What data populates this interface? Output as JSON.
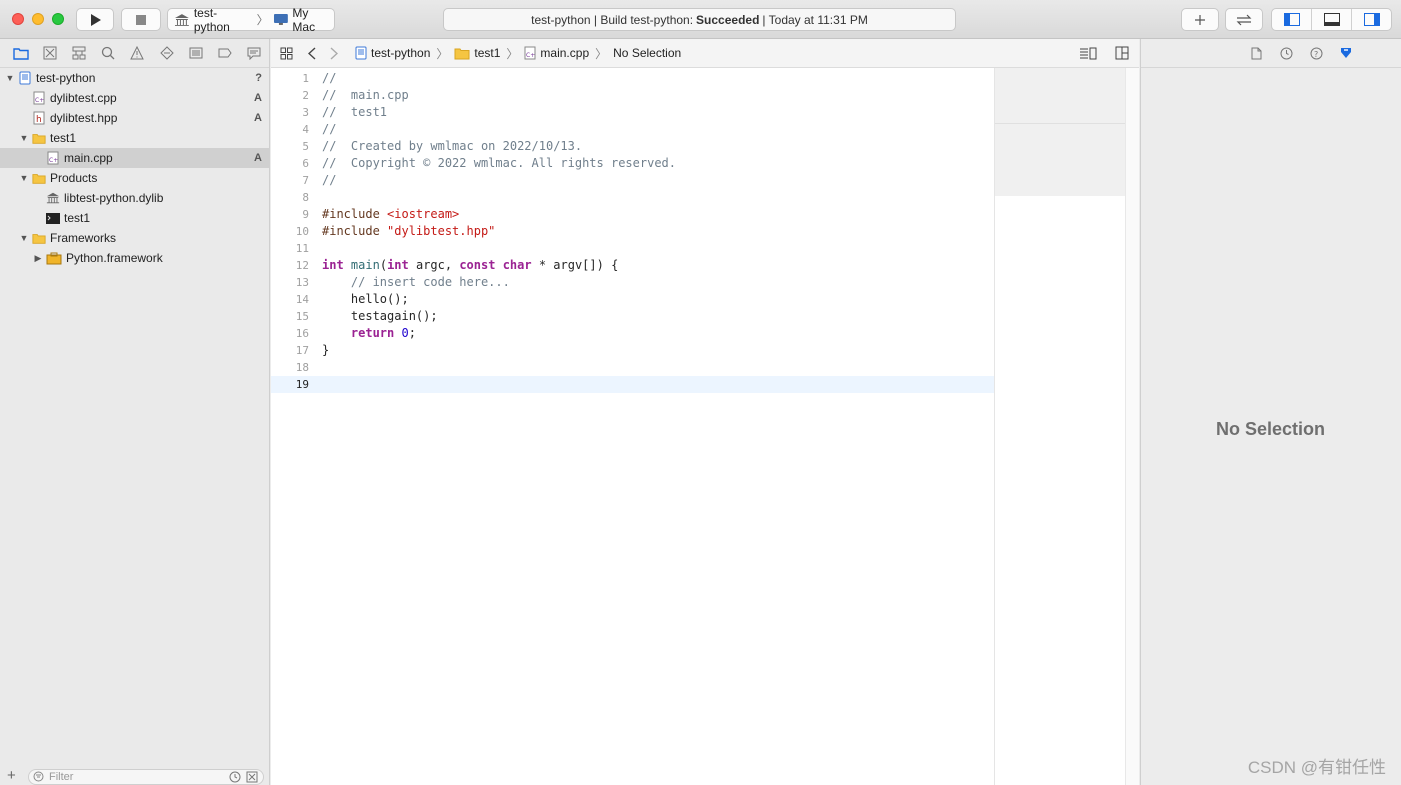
{
  "toolbar": {
    "scheme_name": "test-python",
    "destination": "My Mac",
    "status_prefix": "test-python | Build test-python:",
    "status_result": "Succeeded",
    "status_suffix": "| Today at 11:31 PM"
  },
  "navigator": {
    "tree": [
      {
        "label": "test-python",
        "icon": "project-icon",
        "badge": "?"
      },
      {
        "label": "dylibtest.cpp",
        "icon": "cpp-file-icon",
        "badge": "A"
      },
      {
        "label": "dylibtest.hpp",
        "icon": "header-file-icon",
        "badge": "A"
      },
      {
        "label": "test1",
        "icon": "folder-icon",
        "badge": ""
      },
      {
        "label": "main.cpp",
        "icon": "cpp-file-icon",
        "badge": "A"
      },
      {
        "label": "Products",
        "icon": "folder-icon",
        "badge": ""
      },
      {
        "label": "libtest-python.dylib",
        "icon": "library-icon",
        "badge": ""
      },
      {
        "label": "test1",
        "icon": "executable-icon",
        "badge": ""
      },
      {
        "label": "Frameworks",
        "icon": "folder-icon",
        "badge": ""
      },
      {
        "label": "Python.framework",
        "icon": "framework-icon",
        "badge": ""
      }
    ],
    "filter_placeholder": "Filter"
  },
  "jumpbar": {
    "crumbs": [
      "test-python",
      "test1",
      "main.cpp",
      "No Selection"
    ]
  },
  "editor": {
    "lines": [
      {
        "n": "1",
        "text": "//"
      },
      {
        "n": "2",
        "text": "//  main.cpp"
      },
      {
        "n": "3",
        "text": "//  test1"
      },
      {
        "n": "4",
        "text": "//"
      },
      {
        "n": "5",
        "text": "//  Created by wmlmac on 2022/10/13."
      },
      {
        "n": "6",
        "text": "//  Copyright © 2022 wmlmac. All rights reserved."
      },
      {
        "n": "7",
        "text": "//"
      },
      {
        "n": "8",
        "text": ""
      },
      {
        "n": "9",
        "text": "#include <iostream>"
      },
      {
        "n": "10",
        "text": "#include \"dylibtest.hpp\""
      },
      {
        "n": "11",
        "text": ""
      },
      {
        "n": "12",
        "text": "int main(int argc, const char * argv[]) {"
      },
      {
        "n": "13",
        "text": "    // insert code here..."
      },
      {
        "n": "14",
        "text": "    hello();"
      },
      {
        "n": "15",
        "text": "    testagain();"
      },
      {
        "n": "16",
        "text": "    return 0;"
      },
      {
        "n": "17",
        "text": "}"
      },
      {
        "n": "18",
        "text": ""
      },
      {
        "n": "19",
        "text": ""
      }
    ],
    "current_line": "19"
  },
  "inspector": {
    "empty_label": "No Selection"
  },
  "watermark": "CSDN @有钳任性"
}
